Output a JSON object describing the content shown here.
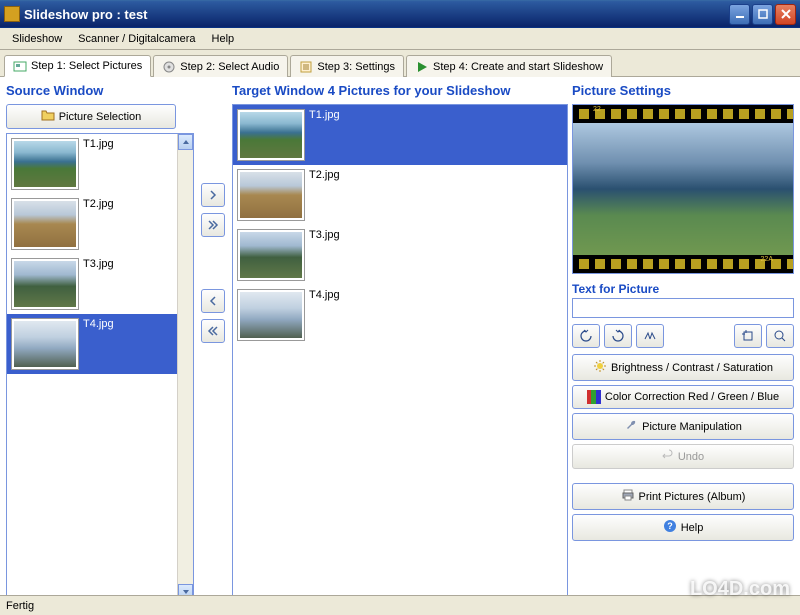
{
  "window": {
    "title": "Slideshow pro : test"
  },
  "menu": {
    "items": [
      "Slideshow",
      "Scanner / Digitalcamera",
      "Help"
    ]
  },
  "tabs": [
    {
      "label": "Step 1: Select Pictures",
      "active": true
    },
    {
      "label": "Step 2: Select Audio",
      "active": false
    },
    {
      "label": "Step 3: Settings",
      "active": false
    },
    {
      "label": "Step 4: Create and start Slideshow",
      "active": false
    }
  ],
  "source": {
    "heading": "Source Window",
    "button": "Picture Selection",
    "items": [
      {
        "label": "T1.jpg",
        "variant": "img-sea",
        "selected": false
      },
      {
        "label": "T2.jpg",
        "variant": "img-fence",
        "selected": false
      },
      {
        "label": "T3.jpg",
        "variant": "img-palms",
        "selected": false
      },
      {
        "label": "T4.jpg",
        "variant": "img-rock",
        "selected": true
      }
    ]
  },
  "target": {
    "heading": "Target Window 4 Pictures for your Slideshow",
    "items": [
      {
        "label": "T1.jpg",
        "variant": "img-sea",
        "selected": true
      },
      {
        "label": "T2.jpg",
        "variant": "img-fence",
        "selected": false
      },
      {
        "label": "T3.jpg",
        "variant": "img-palms",
        "selected": false
      },
      {
        "label": "T4.jpg",
        "variant": "img-rock",
        "selected": false
      }
    ]
  },
  "settings": {
    "heading": "Picture Settings",
    "preview_label_left": "22",
    "preview_label_right": "22A",
    "text_label": "Text for Picture",
    "text_value": "",
    "brightness_btn": "Brightness / Contrast / Saturation",
    "color_btn": "Color Correction Red / Green / Blue",
    "manipulation_btn": "Picture Manipulation",
    "undo_btn": "Undo",
    "print_btn": "Print Pictures (Album)",
    "help_btn": "Help"
  },
  "status": {
    "text": "Fertig"
  },
  "watermark": "LO4D.com"
}
